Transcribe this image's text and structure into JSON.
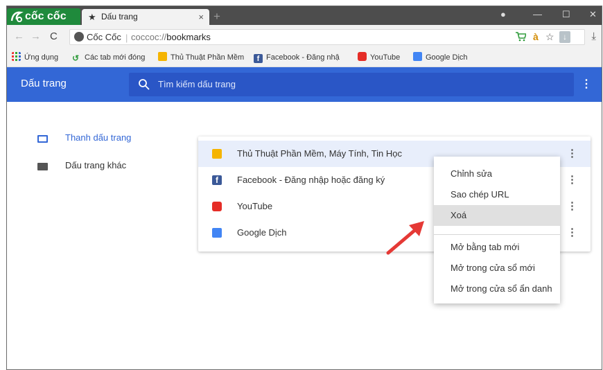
{
  "browser": {
    "brand": "cốc cốc",
    "tab_title": "Dấu trang",
    "tab_close": "×",
    "new_tab": "+",
    "window_controls": {
      "profile": "●",
      "minimize": "—",
      "maximize": "☐",
      "close": "✕"
    }
  },
  "address_bar": {
    "back": "←",
    "forward": "→",
    "reload": "C",
    "site_name": "Cốc Cốc",
    "separator": "|",
    "url_scheme": "coccoc://",
    "url_path": "bookmarks",
    "extensions": [
      "cart-icon",
      "dictionary-icon",
      "star-icon",
      "download-ext-icon"
    ],
    "ext_labels": {
      "dictionary": "à",
      "star": "☆",
      "download_ext": "↓"
    },
    "download": "⤓"
  },
  "bookmarks_bar": {
    "apps_label": "Ứng dụng",
    "items": [
      {
        "label": "Các tab mới đóng",
        "icon": "history-icon"
      },
      {
        "label": "Thủ Thuật Phần Mềm",
        "icon": "ttpm-icon"
      },
      {
        "label": "Facebook - Đăng nhậ",
        "icon": "facebook-icon"
      },
      {
        "label": "YouTube",
        "icon": "youtube-icon"
      },
      {
        "label": "Google Dịch",
        "icon": "google-translate-icon"
      }
    ]
  },
  "page": {
    "title": "Dấu trang",
    "search_placeholder": "Tìm kiếm dấu trang",
    "menu_icon": "⋮"
  },
  "sidebar": {
    "items": [
      {
        "label": "Thanh dấu trang",
        "active": true
      },
      {
        "label": "Dấu trang khác",
        "active": false
      }
    ]
  },
  "bookmarks": [
    {
      "title": "Thủ Thuật Phần Mềm, Máy Tính, Tin Học",
      "icon": "ttpm-icon",
      "selected": true
    },
    {
      "title": "Facebook - Đăng nhập hoặc đăng ký",
      "icon": "facebook-icon",
      "selected": false
    },
    {
      "title": "YouTube",
      "icon": "youtube-icon",
      "selected": false
    },
    {
      "title": "Google Dịch",
      "icon": "google-translate-icon",
      "selected": false
    }
  ],
  "more_icon": "⋮",
  "context_menu": {
    "items": [
      {
        "label": "Chỉnh sửa"
      },
      {
        "label": "Sao chép URL"
      },
      {
        "label": "Xoá",
        "highlighted": true
      },
      {
        "label": "Mở bằng tab mới"
      },
      {
        "label": "Mở trong cửa sổ mới"
      },
      {
        "label": "Mở trong cửa sổ ẩn danh"
      }
    ]
  },
  "colors": {
    "header_blue": "#3367d6",
    "search_blue": "#2a56c6",
    "brand_green": "#1f8a3c",
    "annotation_red": "#e53935",
    "folder_blue": "#3367d6",
    "folder_gray": "#555555"
  }
}
